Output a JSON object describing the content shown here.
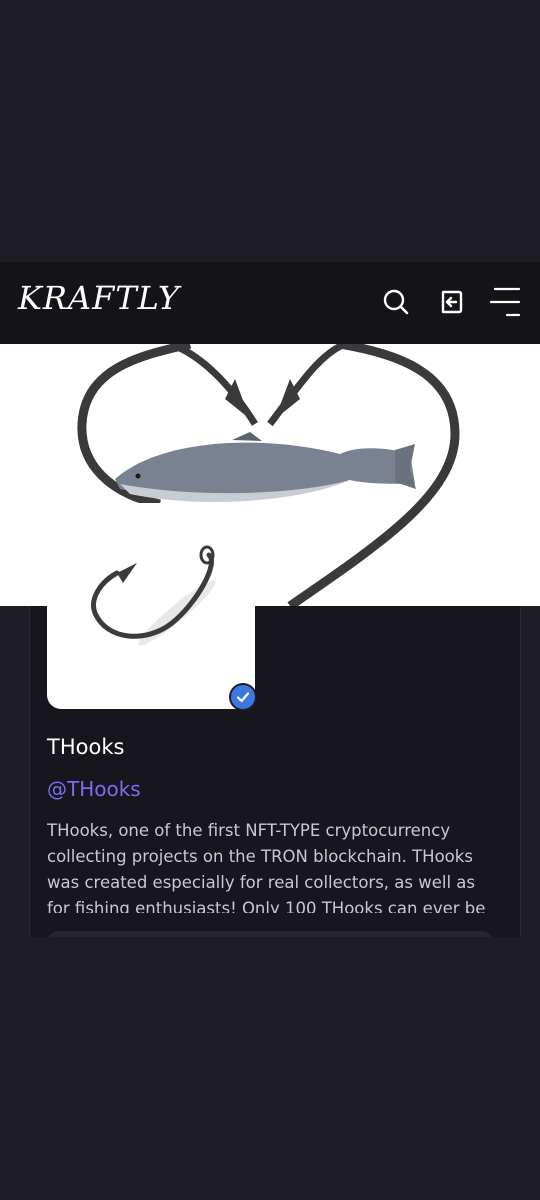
{
  "header": {
    "logo": "KRAFTLY",
    "search_icon": "search-icon",
    "login_icon": "login-icon",
    "menu_icon": "menu-icon"
  },
  "profile": {
    "name": "THooks",
    "handle": "@THooks",
    "verified": true,
    "description": "THooks, one of the first NFT-TYPE cryptocurrency collecting projects on the TRON blockchain. THooks was created especially for real collectors, as well as for fishing enthusiasts! Only 100 THooks can ever be"
  },
  "colors": {
    "background": "#1e1d24",
    "header": "#141318",
    "handle": "#7b6cf0",
    "verified": "#3d78e0"
  }
}
